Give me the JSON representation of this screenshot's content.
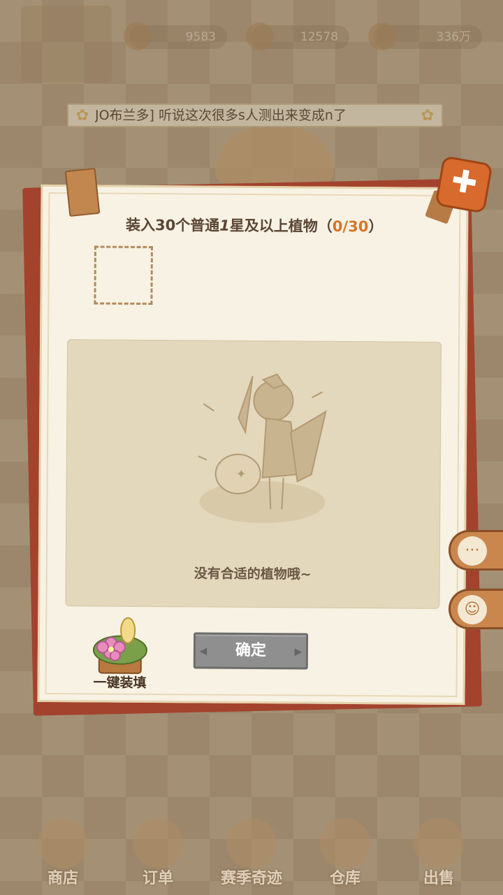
{
  "topbar": {
    "currency": [
      {
        "name": "gem",
        "value": "9583"
      },
      {
        "name": "coin",
        "value": "12578"
      },
      {
        "name": "money",
        "value": "336万"
      }
    ]
  },
  "ticker": {
    "text": "JO布兰多] 听说这次很多s人测出来变成n了"
  },
  "dialog": {
    "title_prefix": "装入30个普通",
    "title_italic": "1",
    "title_suffix": "星及以上植物（",
    "title_count": "0/30",
    "title_close": "）",
    "empty_text": "没有合适的植物哦~",
    "fill_label": "一键装填",
    "confirm_label": "确定"
  },
  "nav": {
    "items": [
      {
        "label": "商店"
      },
      {
        "label": "订单"
      },
      {
        "label": "赛季奇迹"
      },
      {
        "label": "仓库"
      },
      {
        "label": "出售"
      }
    ]
  },
  "colors": {
    "accent_orange": "#d4752a",
    "dialog_red": "#a3432d",
    "dialog_paper": "#f7f2e3",
    "button_gray": "#8f8f8f"
  }
}
